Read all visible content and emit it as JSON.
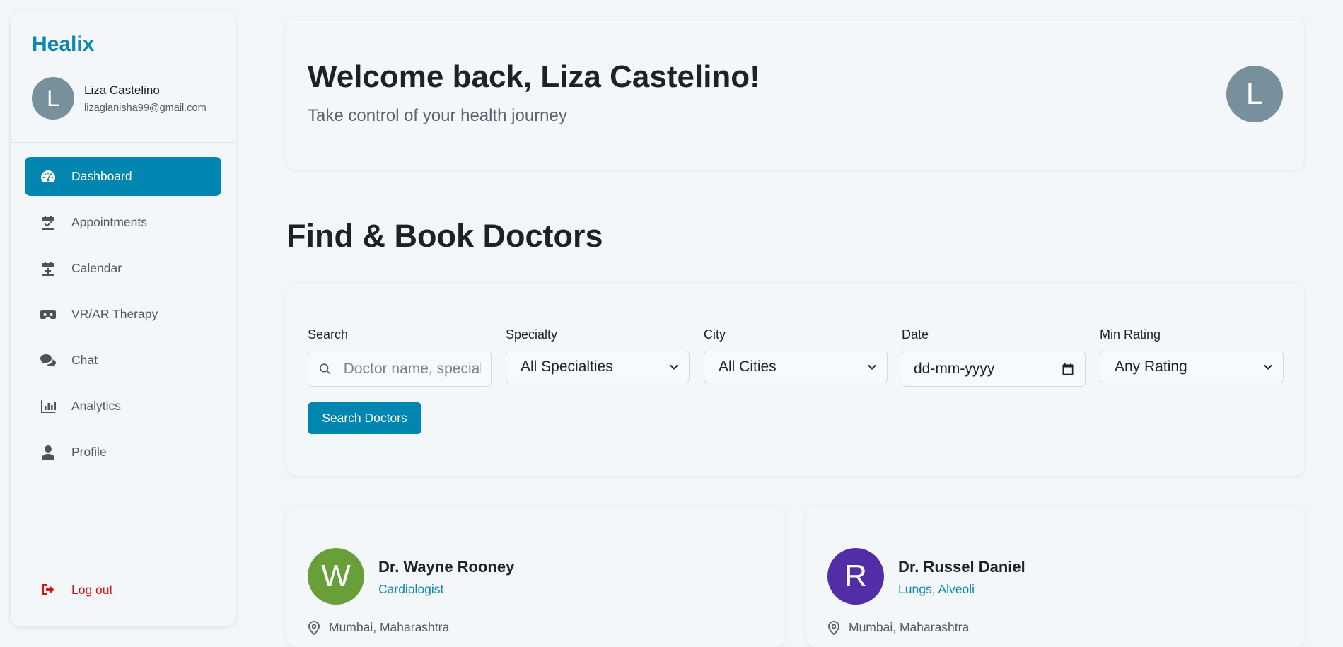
{
  "brand": "Healix",
  "user": {
    "initial": "L",
    "name": "Liza Castelino",
    "email": "lizaglanisha99@gmail.com"
  },
  "nav": [
    {
      "label": "Dashboard",
      "icon": "dashboard-gauge-icon",
      "active": true
    },
    {
      "label": "Appointments",
      "icon": "calendar-check-icon",
      "active": false
    },
    {
      "label": "Calendar",
      "icon": "calendar-plus-icon",
      "active": false
    },
    {
      "label": "VR/AR Therapy",
      "icon": "vr-headset-icon",
      "active": false
    },
    {
      "label": "Chat",
      "icon": "chat-bubbles-icon",
      "active": false
    },
    {
      "label": "Analytics",
      "icon": "bar-chart-icon",
      "active": false
    },
    {
      "label": "Profile",
      "icon": "user-icon",
      "active": false
    }
  ],
  "logout_label": "Log out",
  "welcome": {
    "title": "Welcome back, Liza Castelino!",
    "subtitle": "Take control of your health journey",
    "avatar_initial": "L"
  },
  "section_title": "Find & Book Doctors",
  "filters": {
    "search_label": "Search",
    "search_placeholder": "Doctor name, special",
    "specialty_label": "Specialty",
    "specialty_value": "All Specialties",
    "city_label": "City",
    "city_value": "All Cities",
    "date_label": "Date",
    "date_placeholder": "dd-mm-yyyy",
    "rating_label": "Min Rating",
    "rating_value": "Any Rating",
    "button_label": "Search Doctors"
  },
  "doctors": [
    {
      "initial": "W",
      "name": "Dr. Wayne Rooney",
      "specialty": "Cardiologist",
      "location": "Mumbai, Maharashtra",
      "color": "#689f38"
    },
    {
      "initial": "R",
      "name": "Dr. Russel Daniel",
      "specialty": "Lungs, Alveoli",
      "location": "Mumbai, Maharashtra",
      "color": "#512da8"
    }
  ],
  "colors": {
    "accent": "#0086b1",
    "brand": "#0e87ad",
    "logout": "#dd1111",
    "avatar_grey": "#78909c"
  }
}
